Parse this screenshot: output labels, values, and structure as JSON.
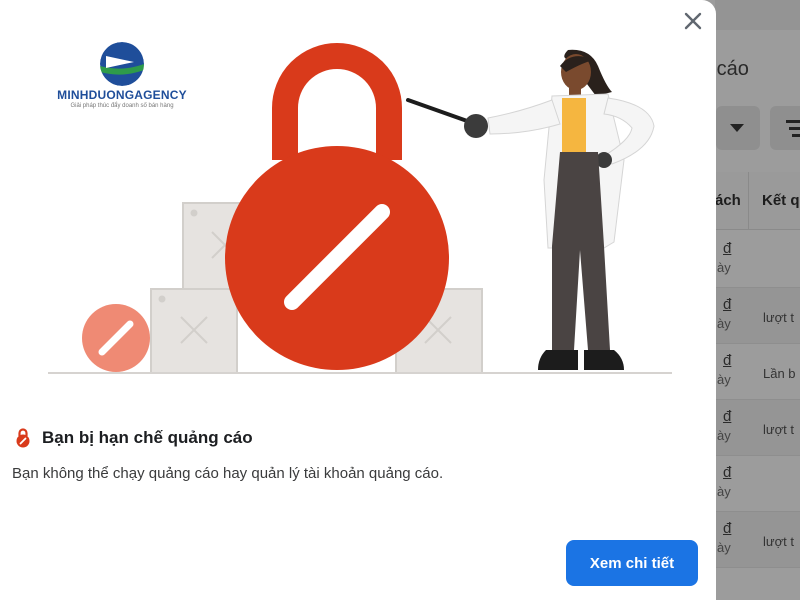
{
  "background_page": {
    "title_fragment": "g cáo",
    "columns": [
      "ách",
      "Kết q"
    ],
    "rows": [
      {
        "currency": "đ",
        "sub": "ày",
        "result": ""
      },
      {
        "currency": "đ",
        "sub": "ày",
        "result": "lượt t"
      },
      {
        "currency": "đ",
        "sub": "ày",
        "result": "Lần b"
      },
      {
        "currency": "đ",
        "sub": "ày",
        "result": "lượt t"
      },
      {
        "currency": "đ",
        "sub": "ày",
        "result": ""
      },
      {
        "currency": "đ",
        "sub": "ày",
        "result": "lượt t"
      }
    ]
  },
  "watermark": {
    "name": "MINHDUONGAGENCY",
    "tagline": "Giải pháp thúc đẩy doanh số bán hàng",
    "colors": {
      "blue": "#1f4e9a",
      "green": "#2e9b4a"
    }
  },
  "modal": {
    "close_icon": "close-icon",
    "heading_icon": "restricted-lock-icon",
    "heading": "Bạn bị hạn chế quảng cáo",
    "description": "Bạn không thể chạy quảng cáo hay quản lý tài khoản quảng cáo.",
    "primary_button": "Xem chi tiết",
    "colors": {
      "accent": "#1b74e4",
      "lock_red": "#d93a1b"
    }
  }
}
